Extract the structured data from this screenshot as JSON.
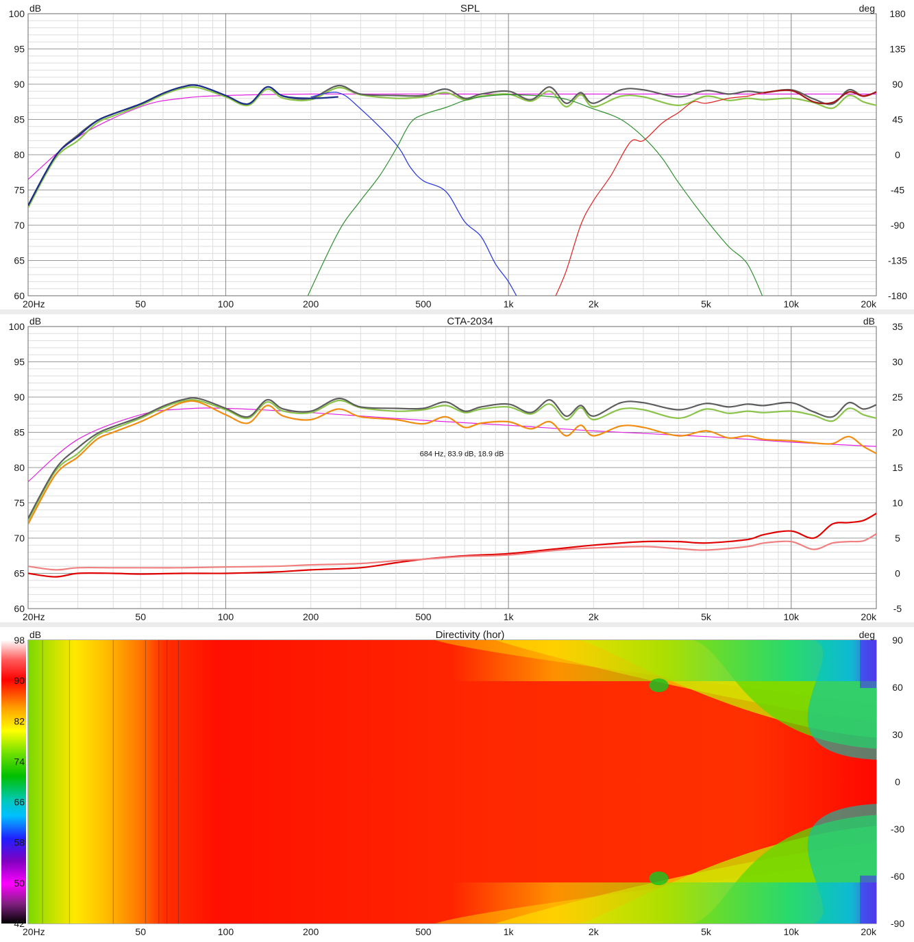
{
  "x_ticks": [
    "20Hz",
    "50",
    "100",
    "200",
    "500",
    "1k",
    "2k",
    "5k",
    "10k",
    "20k"
  ],
  "x_tick_values": [
    20,
    50,
    100,
    200,
    500,
    1000,
    2000,
    5000,
    10000,
    20000
  ],
  "colors": {
    "olive": "#8bc34a",
    "darkgray": "#5d5d5d",
    "navy": "#1b2e8a",
    "blue": "#2030e0",
    "green": "#2f8f2f",
    "red": "#e02020",
    "magenta": "#e020e0",
    "darkred": "#a01818",
    "orange": "#f08c10",
    "pink": "#f08080",
    "crimson": "#e00000"
  },
  "chart_data": [
    {
      "type": "line",
      "title": "SPL",
      "ylabel": "dB",
      "y2label": "deg",
      "xlim": [
        20,
        20000
      ],
      "ylim": [
        60,
        100
      ],
      "y2lim": [
        -180,
        180
      ],
      "x_scale": "log",
      "grid": true,
      "y_ticks": [
        "100",
        "95",
        "90",
        "85",
        "80",
        "75",
        "70",
        "65",
        "60"
      ],
      "y2_ticks": [
        "180",
        "135",
        "90",
        "45",
        "0",
        "-45",
        "-90",
        "-135",
        "-180"
      ],
      "series": [
        {
          "color": "magenta",
          "x": [
            20,
            30,
            50,
            70,
            100,
            200,
            500,
            1000,
            5000,
            20000
          ],
          "y": [
            76.5,
            82.5,
            86.8,
            88,
            88.4,
            88.6,
            88.6,
            88.6,
            88.6,
            88.6
          ]
        },
        {
          "color": "olive",
          "x": [
            20,
            25,
            30,
            35,
            40,
            50,
            60,
            70,
            80,
            100,
            120,
            140,
            160,
            200,
            250,
            300,
            400,
            500,
            600,
            700,
            800,
            1000,
            1200,
            1400,
            1600,
            1800,
            2000,
            2500,
            3000,
            4000,
            5000,
            6000,
            7000,
            8000,
            10000,
            12000,
            14000,
            16000,
            18000,
            20000
          ],
          "y": [
            72.5,
            79.5,
            82,
            84.5,
            85.5,
            87,
            88.5,
            89.4,
            89.5,
            88.2,
            87,
            89.3,
            88,
            87.8,
            89.5,
            88.5,
            88,
            88.2,
            88.8,
            87.8,
            88.3,
            88.6,
            87.6,
            89,
            86.8,
            88.5,
            86.8,
            88.3,
            88.2,
            87,
            88.3,
            87.7,
            88,
            87.8,
            88,
            87.4,
            86.6,
            88.4,
            87.5,
            87
          ]
        },
        {
          "color": "darkgray",
          "x": [
            20,
            25,
            30,
            35,
            40,
            50,
            60,
            70,
            80,
            100,
            120,
            140,
            160,
            200,
            250,
            300,
            400,
            500,
            600,
            700,
            800,
            1000,
            1200,
            1400,
            1600,
            1800,
            2000,
            2500,
            3000,
            4000,
            5000,
            6000,
            7000,
            8000,
            10000,
            12000,
            14000,
            16000,
            18000,
            20000
          ],
          "y": [
            72.8,
            79.8,
            82.8,
            84.8,
            85.8,
            87.2,
            88.7,
            89.6,
            89.8,
            88.4,
            87.2,
            89.6,
            88.3,
            88,
            89.8,
            88.6,
            88.4,
            88.4,
            89.3,
            88,
            88.6,
            89,
            87.8,
            89.6,
            87.3,
            88.8,
            87.3,
            89.2,
            89.2,
            88.2,
            89.1,
            88.6,
            89,
            88.8,
            89.2,
            87.9,
            87.2,
            89.2,
            88.3,
            88.9
          ]
        },
        {
          "color": "navy",
          "x": [
            20,
            25,
            30,
            35,
            40,
            50,
            60,
            70,
            80,
            100,
            120,
            140,
            160,
            200,
            250
          ],
          "y": [
            72.8,
            79.8,
            82.6,
            84.8,
            85.8,
            87.2,
            88.7,
            89.6,
            89.8,
            88.4,
            87.2,
            89.6,
            88.3,
            88,
            88.2
          ]
        },
        {
          "color": "blue",
          "x": [
            200,
            250,
            300,
            400,
            450,
            500,
            600,
            700,
            800,
            900,
            1000,
            1100
          ],
          "y": [
            88.2,
            88.8,
            86.5,
            81.5,
            78.2,
            76.3,
            74.8,
            70.5,
            68.4,
            64.5,
            62,
            59
          ]
        },
        {
          "color": "green",
          "x": [
            190,
            250,
            300,
            350,
            400,
            450,
            500,
            600,
            700,
            800,
            1000,
            1500,
            2000,
            2500,
            3000,
            3500,
            4000,
            5000,
            6000,
            7000,
            8000
          ],
          "y": [
            59,
            69,
            73.5,
            77,
            80.8,
            84.5,
            85.7,
            86.7,
            87.7,
            88.2,
            88.5,
            88.1,
            86.5,
            85,
            82.5,
            79.5,
            76,
            70.8,
            67,
            64.5,
            59.5
          ]
        },
        {
          "color": "red",
          "x": [
            1450,
            1600,
            1800,
            2000,
            2300,
            2700,
            3000,
            3500,
            4000,
            4500,
            5000,
            6000,
            7000,
            8000,
            10000,
            12000,
            14000,
            16000,
            18000,
            20000
          ],
          "y": [
            59.5,
            63.5,
            70,
            73.5,
            77,
            81.8,
            82,
            84.5,
            86,
            87.5,
            87.3,
            88,
            88.3,
            88.8,
            89.1,
            87.5,
            87.4,
            88.9,
            88.4,
            88.9
          ]
        },
        {
          "color": "darkred",
          "x": [
            8000,
            10000,
            12000,
            14000,
            16000,
            18000,
            20000
          ],
          "y": [
            88.8,
            89.1,
            87.5,
            87.4,
            88.9,
            88.3,
            88.9
          ]
        }
      ]
    },
    {
      "type": "line",
      "title": "CTA-2034",
      "ylabel": "dB",
      "y2label": "dB",
      "xlim": [
        20,
        20000
      ],
      "ylim": [
        60,
        100
      ],
      "y2lim": [
        -5,
        35
      ],
      "x_scale": "log",
      "grid": true,
      "y_ticks": [
        "100",
        "95",
        "90",
        "85",
        "80",
        "75",
        "70",
        "65",
        "60"
      ],
      "y2_ticks": [
        "35",
        "30",
        "25",
        "20",
        "15",
        "10",
        "5",
        "0",
        "-5"
      ],
      "annotation": "684 Hz, 83.9 dB, 18.9 dB",
      "annotation_x": 684,
      "annotation_y": 82,
      "series": [
        {
          "color": "magenta",
          "x": [
            20,
            30,
            50,
            70,
            100,
            200,
            500,
            1000,
            2000,
            5000,
            10000,
            20000
          ],
          "y": [
            78,
            84,
            87.5,
            88.3,
            88.4,
            87.8,
            86.7,
            86,
            85.2,
            84.4,
            83.6,
            83
          ]
        },
        {
          "color": "olive",
          "x": [
            20,
            25,
            30,
            35,
            40,
            50,
            60,
            70,
            80,
            100,
            120,
            140,
            160,
            200,
            250,
            300,
            400,
            500,
            600,
            700,
            800,
            1000,
            1200,
            1400,
            1600,
            1800,
            2000,
            2500,
            3000,
            4000,
            5000,
            6000,
            7000,
            8000,
            10000,
            12000,
            14000,
            16000,
            18000,
            20000
          ],
          "y": [
            72.5,
            79.5,
            82,
            84.5,
            85.5,
            87,
            88.5,
            89.4,
            89.5,
            88.2,
            87,
            89.3,
            88,
            87.8,
            89.5,
            88.5,
            88,
            88.2,
            88.8,
            87.8,
            88.3,
            88.6,
            87.6,
            89,
            86.8,
            88.5,
            86.8,
            88.3,
            88.2,
            87,
            88.3,
            87.7,
            88,
            87.8,
            88,
            87.4,
            86.6,
            88.4,
            87.5,
            87
          ]
        },
        {
          "color": "darkgray",
          "x": [
            20,
            25,
            30,
            35,
            40,
            50,
            60,
            70,
            80,
            100,
            120,
            140,
            160,
            200,
            250,
            300,
            400,
            500,
            600,
            700,
            800,
            1000,
            1200,
            1400,
            1600,
            1800,
            2000,
            2500,
            3000,
            4000,
            5000,
            6000,
            7000,
            8000,
            10000,
            12000,
            14000,
            16000,
            18000,
            20000
          ],
          "y": [
            72.8,
            79.8,
            82.8,
            84.8,
            85.8,
            87.2,
            88.7,
            89.6,
            89.8,
            88.4,
            87.2,
            89.6,
            88.3,
            88,
            89.8,
            88.6,
            88.4,
            88.4,
            89.3,
            88,
            88.6,
            89,
            87.8,
            89.6,
            87.3,
            88.8,
            87.3,
            89.2,
            89.2,
            88.2,
            89.1,
            88.6,
            89,
            88.8,
            89.2,
            87.9,
            87.2,
            89.2,
            88.3,
            88.9
          ]
        },
        {
          "color": "orange",
          "x": [
            20,
            25,
            30,
            35,
            40,
            50,
            60,
            70,
            80,
            100,
            120,
            140,
            160,
            200,
            250,
            300,
            400,
            500,
            600,
            700,
            800,
            1000,
            1200,
            1400,
            1600,
            1800,
            2000,
            2500,
            3000,
            4000,
            5000,
            6000,
            7000,
            8000,
            10000,
            12000,
            14000,
            16000,
            18000,
            20000
          ],
          "y": [
            72,
            79,
            81.5,
            84,
            85,
            86.5,
            88,
            89.2,
            89.3,
            87.5,
            86.3,
            88.8,
            87.3,
            86.8,
            88.3,
            87.2,
            86.8,
            86.2,
            87.2,
            85.7,
            86.3,
            86.5,
            85.5,
            86.5,
            84.5,
            86,
            84.5,
            85.9,
            85.7,
            84.5,
            85.2,
            84.2,
            84.5,
            84,
            83.8,
            83.5,
            83.4,
            84.4,
            83,
            82
          ]
        },
        {
          "color": "crimson",
          "x": [
            20,
            25,
            30,
            40,
            50,
            70,
            100,
            150,
            200,
            300,
            400,
            500,
            700,
            1000,
            1500,
            2000,
            3000,
            4000,
            5000,
            7000,
            8000,
            10000,
            12000,
            14000,
            16000,
            18000,
            20000
          ],
          "y": [
            65,
            64.5,
            65,
            65,
            64.9,
            65,
            65,
            65.2,
            65.5,
            65.8,
            66.5,
            67,
            67.5,
            67.8,
            68.5,
            69,
            69.5,
            69.5,
            69.3,
            69.8,
            70.5,
            71,
            70,
            72,
            72.2,
            72.5,
            73.5
          ]
        },
        {
          "color": "pink",
          "x": [
            20,
            25,
            30,
            40,
            50,
            70,
            100,
            150,
            200,
            300,
            400,
            500,
            700,
            1000,
            1500,
            2000,
            3000,
            4000,
            5000,
            7000,
            8000,
            10000,
            12000,
            14000,
            16000,
            18000,
            20000
          ],
          "y": [
            66,
            65.5,
            65.8,
            65.8,
            65.8,
            65.8,
            65.9,
            66,
            66.2,
            66.4,
            66.8,
            67,
            67.4,
            67.6,
            68.3,
            68.6,
            68.8,
            68.5,
            68.3,
            68.8,
            69.3,
            69.5,
            68.4,
            69.3,
            69.5,
            69.6,
            70.6
          ]
        }
      ]
    },
    {
      "type": "heatmap",
      "title": "Directivity (hor)",
      "ylabel": "dB",
      "y2label": "deg",
      "xlim": [
        20,
        20000
      ],
      "y2lim": [
        -90,
        90
      ],
      "x_scale": "log",
      "grid": true,
      "colorbar_ticks": [
        "98",
        "90",
        "82",
        "74",
        "66",
        "58",
        "50",
        "42"
      ],
      "colorbar_range": [
        42,
        98
      ],
      "y2_ticks": [
        "90",
        "60",
        "30",
        "0",
        "-30",
        "-60",
        "-90"
      ]
    }
  ]
}
